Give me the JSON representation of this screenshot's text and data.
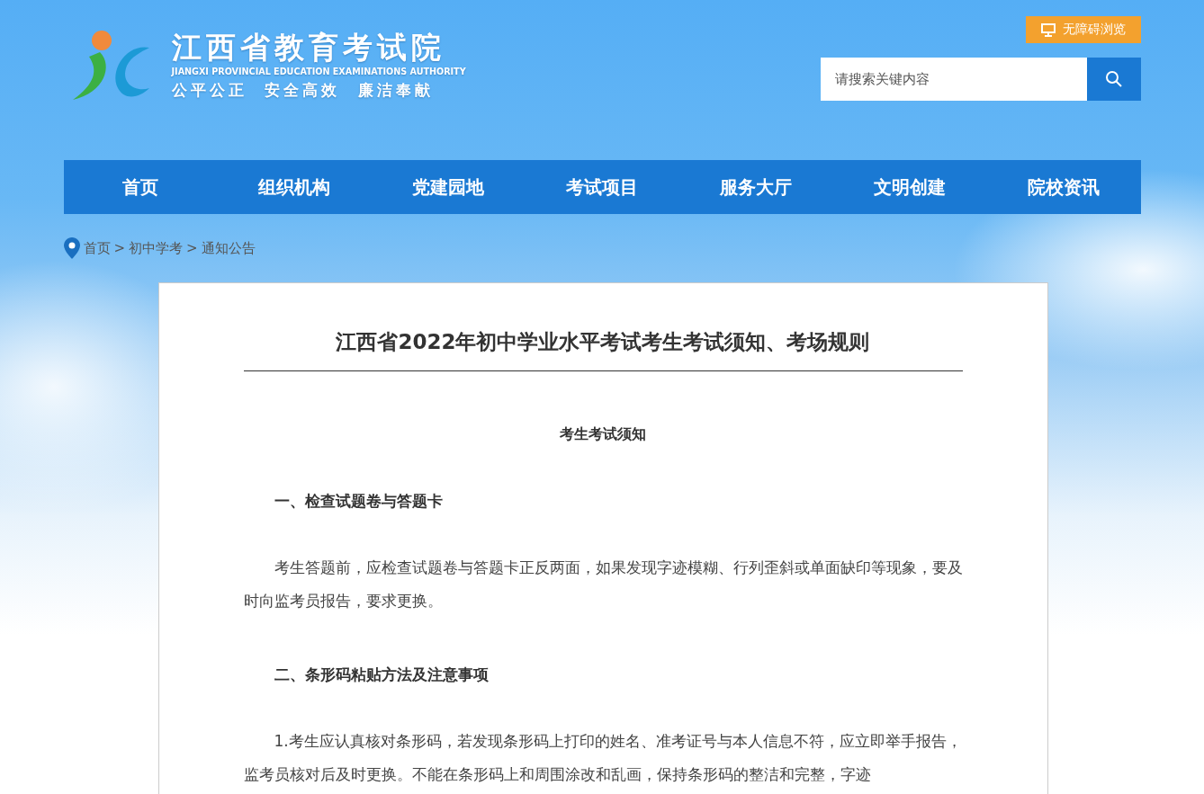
{
  "header": {
    "site_title": "江西省教育考试院",
    "site_subtitle": "JIANGXI PROVINCIAL EDUCATION EXAMINATIONS AUTHORITY",
    "slogan": "公平公正  安全高效  廉洁奉献",
    "accessibility_button": "无障碍浏览",
    "search": {
      "placeholder": "请搜索关键内容"
    }
  },
  "nav": [
    {
      "label": "首页"
    },
    {
      "label": "组织机构"
    },
    {
      "label": "党建园地"
    },
    {
      "label": "考试项目"
    },
    {
      "label": "服务大厅"
    },
    {
      "label": "文明创建"
    },
    {
      "label": "院校资讯"
    }
  ],
  "breadcrumb": {
    "separator": ">",
    "items": [
      {
        "label": "首页"
      },
      {
        "label": "初中学考"
      },
      {
        "label": "通知公告"
      }
    ]
  },
  "article": {
    "title": "江西省2022年初中学业水平考试考生考试须知、考场规则",
    "blocks": [
      {
        "kind": "center",
        "text": "考生考试须知"
      },
      {
        "kind": "heading",
        "text": "一、检查试题卷与答题卡"
      },
      {
        "kind": "paragraph",
        "text": "考生答题前，应检查试题卷与答题卡正反两面，如果发现字迹模糊、行列歪斜或单面缺印等现象，要及时向监考员报告，要求更换。"
      },
      {
        "kind": "heading",
        "text": "二、条形码粘贴方法及注意事项"
      },
      {
        "kind": "paragraph",
        "text": "1.考生应认真核对条形码，若发现条形码上打印的姓名、准考证号与本人信息不符，应立即举手报告，监考员核对后及时更换。不能在条形码上和周围涂改和乱画，保持条形码的整洁和完整，字迹"
      }
    ]
  }
}
